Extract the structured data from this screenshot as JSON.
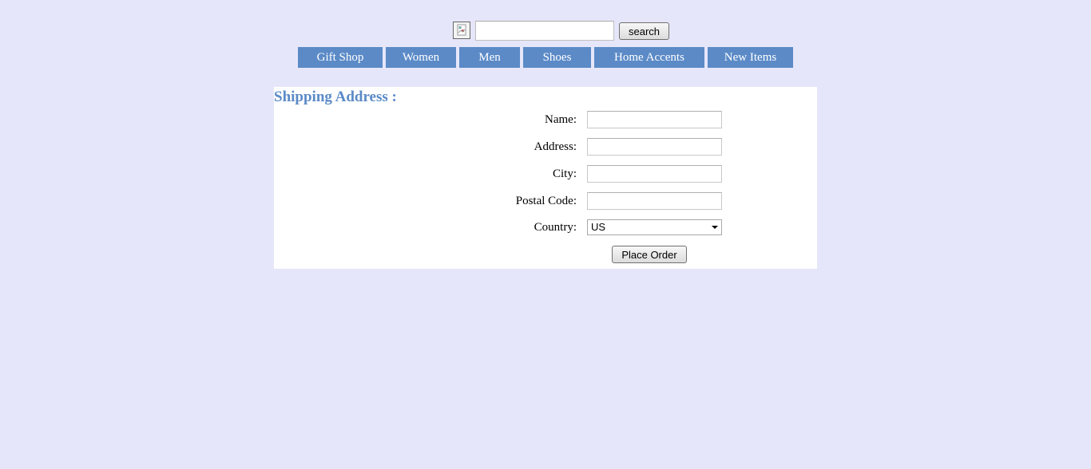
{
  "search": {
    "value": "",
    "placeholder": "",
    "button_label": "search"
  },
  "icons": {
    "logo": "broken-image-icon",
    "select_arrow": "chevron-down-icon"
  },
  "nav": {
    "items": [
      {
        "label": "Gift Shop"
      },
      {
        "label": "Women"
      },
      {
        "label": "Men"
      },
      {
        "label": "Shoes"
      },
      {
        "label": "Home Accents"
      },
      {
        "label": "New Items"
      }
    ]
  },
  "form": {
    "title": "Shipping Address :",
    "fields": {
      "name": {
        "label": "Name:",
        "value": ""
      },
      "address": {
        "label": "Address:",
        "value": ""
      },
      "city": {
        "label": "City:",
        "value": ""
      },
      "postal_code": {
        "label": "Postal Code:",
        "value": ""
      },
      "country": {
        "label": "Country:",
        "value": "US"
      }
    },
    "submit_label": "Place Order"
  },
  "colors": {
    "page_background": "#e6e6fa",
    "accent": "#5b8ac7",
    "panel_background": "#ffffff"
  }
}
